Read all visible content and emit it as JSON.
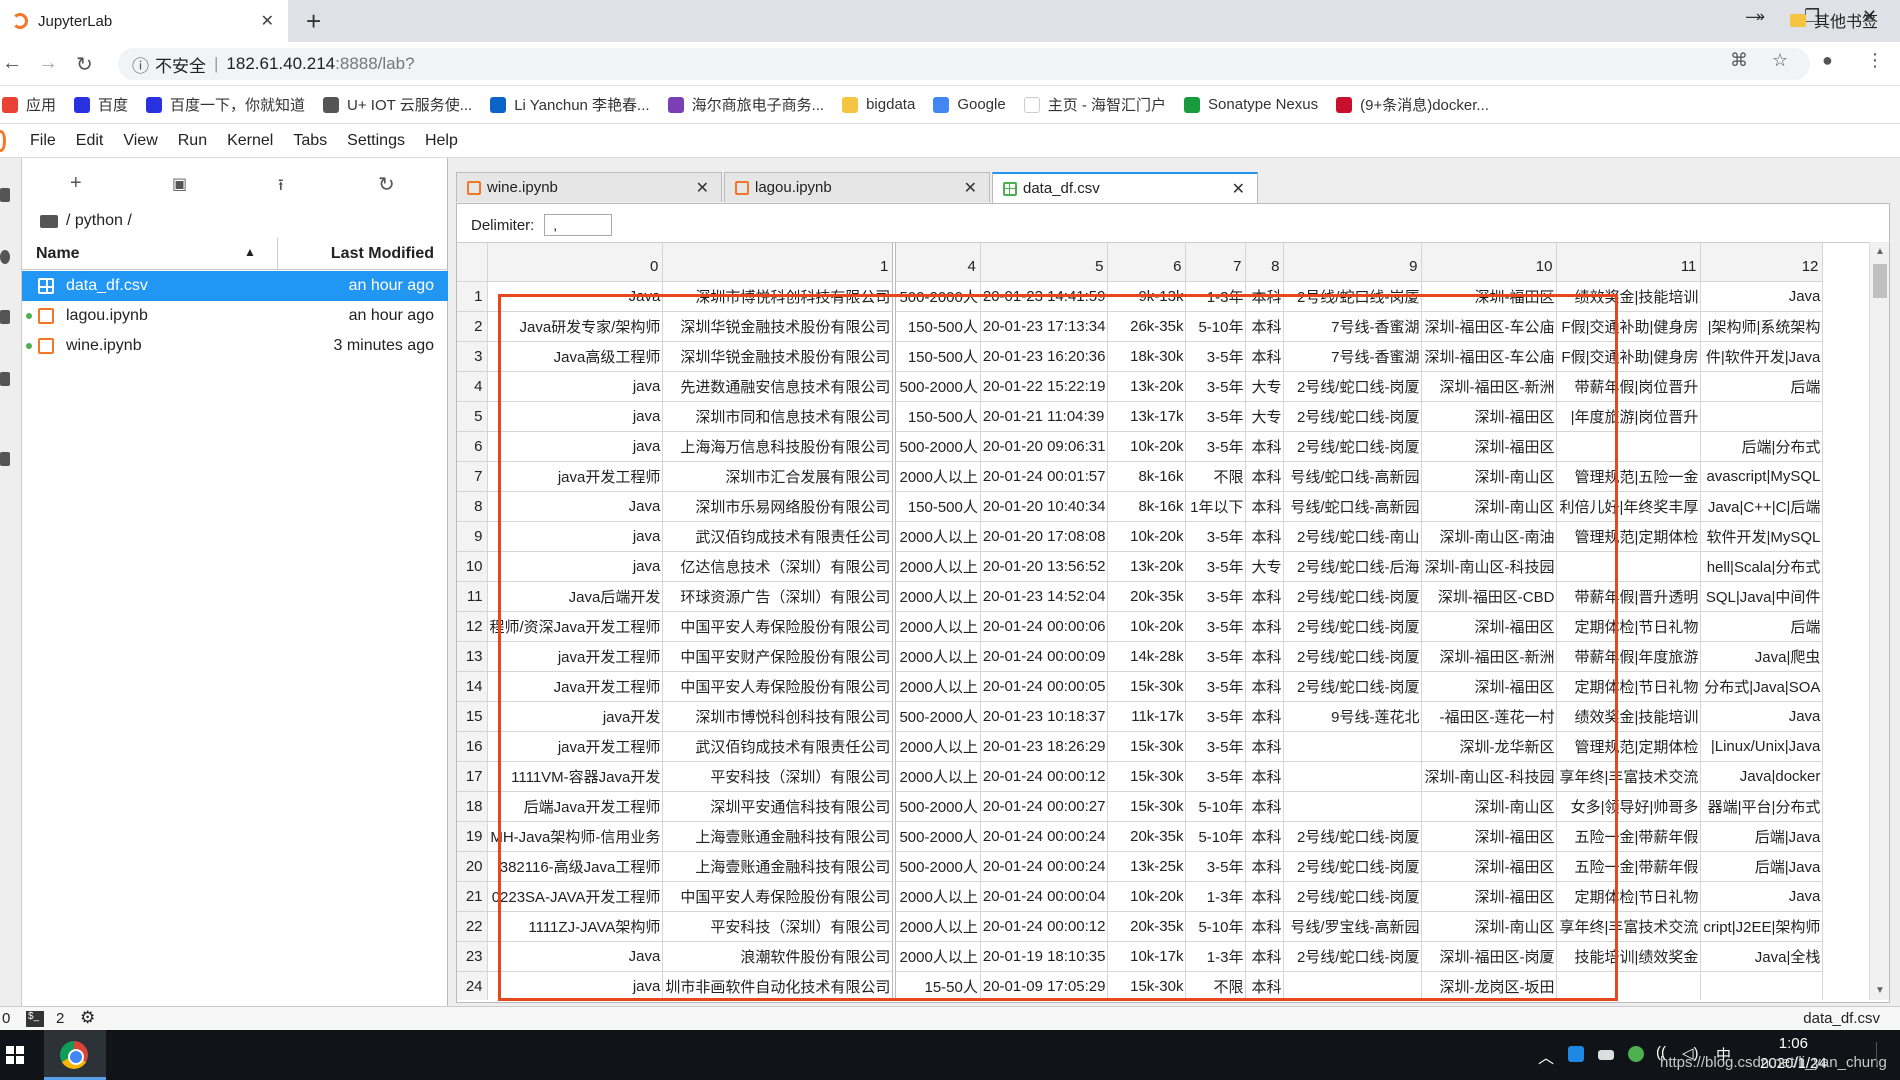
{
  "browser": {
    "tab_title": "JupyterLab",
    "address": {
      "warning": "不安全",
      "host": "182.61.40.214",
      "rest": ":8888/lab?"
    },
    "bookmarks": [
      {
        "label": "应用",
        "icon": "apps-grid-icon",
        "color": "#e94235"
      },
      {
        "label": "百度",
        "icon": "baidu-paw-icon",
        "color": "#2932e1"
      },
      {
        "label": "百度一下，你就知道",
        "icon": "baidu-paw-icon",
        "color": "#2932e1"
      },
      {
        "label": "U+ IOT 云服务使...",
        "icon": "globe-icon",
        "color": "#555555"
      },
      {
        "label": "Li Yanchun 李艳春...",
        "icon": "outlook-icon",
        "color": "#0a64c8"
      },
      {
        "label": "海尔商旅电子商务...",
        "icon": "colorful-ball-icon",
        "color": "#7b3fb5"
      },
      {
        "label": "bigdata",
        "icon": "folder-icon",
        "color": "#f5c542"
      },
      {
        "label": "Google",
        "icon": "google-icon",
        "color": "#4285f4"
      },
      {
        "label": "主页 - 海智汇门户",
        "icon": "blank-page-icon",
        "color": "#ffffff"
      },
      {
        "label": "Sonatype Nexus",
        "icon": "nexus-icon",
        "color": "#1a9c3e"
      },
      {
        "label": "(9+条消息)docker...",
        "icon": "csdn-icon",
        "color": "#c8102e"
      }
    ],
    "more_label": "»",
    "other_bookmarks": "其他书签"
  },
  "menu": [
    "File",
    "Edit",
    "View",
    "Run",
    "Kernel",
    "Tabs",
    "Settings",
    "Help"
  ],
  "filebrowser": {
    "breadcrumb": "/ python /",
    "col_name": "Name",
    "col_modified": "Last Modified",
    "files": [
      {
        "name": "data_df.csv",
        "modified": "an hour ago",
        "selected": true,
        "type": "csv",
        "running": false
      },
      {
        "name": "lagou.ipynb",
        "modified": "an hour ago",
        "selected": false,
        "type": "notebook",
        "running": true
      },
      {
        "name": "wine.ipynb",
        "modified": "3 minutes ago",
        "selected": false,
        "type": "notebook",
        "running": true
      }
    ]
  },
  "doc_tabs": [
    {
      "label": "wine.ipynb",
      "active": false,
      "type": "notebook"
    },
    {
      "label": "lagou.ipynb",
      "active": false,
      "type": "notebook"
    },
    {
      "label": "data_df.csv",
      "active": true,
      "type": "csv"
    }
  ],
  "delimiter": {
    "label": "Delimiter:",
    "value": ","
  },
  "grid": {
    "columns": [
      "0",
      "1",
      "4",
      "5",
      "6",
      "7",
      "8",
      "9",
      "10",
      "11",
      "12"
    ],
    "rows": [
      {
        "i": "1",
        "c": [
          "Java",
          "深圳市博悦科创科技有限公司",
          "500-2000人",
          "20-01-23 14:41:59",
          "9k-13k",
          "1-3年",
          "本科",
          "2号线/蛇口线-岗厦",
          "深圳-福田区",
          "绩效奖金|技能培训",
          "Java"
        ]
      },
      {
        "i": "2",
        "c": [
          "Java研发专家/架构师",
          "深圳华锐金融技术股份有限公司",
          "150-500人",
          "20-01-23 17:13:34",
          "26k-35k",
          "5-10年",
          "本科",
          "7号线-香蜜湖",
          "深圳-福田区-车公庙",
          "F假|交通补助|健身房",
          "|架构师|系统架构"
        ]
      },
      {
        "i": "3",
        "c": [
          "Java高级工程师",
          "深圳华锐金融技术股份有限公司",
          "150-500人",
          "20-01-23 16:20:36",
          "18k-30k",
          "3-5年",
          "本科",
          "7号线-香蜜湖",
          "深圳-福田区-车公庙",
          "F假|交通补助|健身房",
          "件|软件开发|Java"
        ]
      },
      {
        "i": "4",
        "c": [
          "java",
          "先进数通融安信息技术有限公司",
          "500-2000人",
          "20-01-22 15:22:19",
          "13k-20k",
          "3-5年",
          "大专",
          "2号线/蛇口线-岗厦",
          "深圳-福田区-新洲",
          "带薪年假|岗位晋升",
          "后端"
        ]
      },
      {
        "i": "5",
        "c": [
          "java",
          "深圳市同和信息技术有限公司",
          "150-500人",
          "20-01-21 11:04:39",
          "13k-17k",
          "3-5年",
          "大专",
          "2号线/蛇口线-岗厦",
          "深圳-福田区",
          "|年度旅游|岗位晋升",
          ""
        ]
      },
      {
        "i": "6",
        "c": [
          "java",
          "上海海万信息科技股份有限公司",
          "500-2000人",
          "20-01-20 09:06:31",
          "10k-20k",
          "3-5年",
          "本科",
          "2号线/蛇口线-岗厦",
          "深圳-福田区",
          "",
          "后端|分布式"
        ]
      },
      {
        "i": "7",
        "c": [
          "java开发工程师",
          "深圳市汇合发展有限公司",
          "2000人以上",
          "20-01-24 00:01:57",
          "8k-16k",
          "不限",
          "本科",
          "号线/蛇口线-高新园",
          "深圳-南山区",
          "管理规范|五险一金",
          "avascript|MySQL"
        ]
      },
      {
        "i": "8",
        "c": [
          "Java",
          "深圳市乐易网络股份有限公司",
          "150-500人",
          "20-01-20 10:40:34",
          "8k-16k",
          "1年以下",
          "本科",
          "号线/蛇口线-高新园",
          "深圳-南山区",
          "利倍儿好|年终奖丰厚",
          "Java|C++|C|后端"
        ]
      },
      {
        "i": "9",
        "c": [
          "java",
          "武汉佰钧成技术有限责任公司",
          "2000人以上",
          "20-01-20 17:08:08",
          "10k-20k",
          "3-5年",
          "本科",
          "2号线/蛇口线-南山",
          "深圳-南山区-南油",
          "管理规范|定期体检",
          "软件开发|MySQL"
        ]
      },
      {
        "i": "10",
        "c": [
          "java",
          "亿达信息技术（深圳）有限公司",
          "2000人以上",
          "20-01-20 13:56:52",
          "13k-20k",
          "3-5年",
          "大专",
          "2号线/蛇口线-后海",
          "深圳-南山区-科技园",
          "",
          "hell|Scala|分布式"
        ]
      },
      {
        "i": "11",
        "c": [
          "Java后端开发",
          "环球资源广告（深圳）有限公司",
          "2000人以上",
          "20-01-23 14:52:04",
          "20k-35k",
          "3-5年",
          "本科",
          "2号线/蛇口线-岗厦",
          "深圳-福田区-CBD",
          "带薪年假|晋升透明",
          "SQL|Java|中间件"
        ]
      },
      {
        "i": "12",
        "c": [
          "程师/资深Java开发工程师",
          "中国平安人寿保险股份有限公司",
          "2000人以上",
          "20-01-24 00:00:06",
          "10k-20k",
          "3-5年",
          "本科",
          "2号线/蛇口线-岗厦",
          "深圳-福田区",
          "定期体检|节日礼物",
          "后端"
        ]
      },
      {
        "i": "13",
        "c": [
          "java开发工程师",
          "中国平安财产保险股份有限公司",
          "2000人以上",
          "20-01-24 00:00:09",
          "14k-28k",
          "3-5年",
          "本科",
          "2号线/蛇口线-岗厦",
          "深圳-福田区-新洲",
          "带薪年假|年度旅游",
          "Java|爬虫"
        ]
      },
      {
        "i": "14",
        "c": [
          "Java开发工程师",
          "中国平安人寿保险股份有限公司",
          "2000人以上",
          "20-01-24 00:00:05",
          "15k-30k",
          "3-5年",
          "本科",
          "2号线/蛇口线-岗厦",
          "深圳-福田区",
          "定期体检|节日礼物",
          "分布式|Java|SOA"
        ]
      },
      {
        "i": "15",
        "c": [
          "java开发",
          "深圳市博悦科创科技有限公司",
          "500-2000人",
          "20-01-23 10:18:37",
          "11k-17k",
          "3-5年",
          "本科",
          "9号线-莲花北",
          "-福田区-莲花一村",
          "绩效奖金|技能培训",
          "Java"
        ]
      },
      {
        "i": "16",
        "c": [
          "java开发工程师",
          "武汉佰钧成技术有限责任公司",
          "2000人以上",
          "20-01-23 18:26:29",
          "15k-30k",
          "3-5年",
          "本科",
          "",
          "深圳-龙华新区",
          "管理规范|定期体检",
          "|Linux/Unix|Java"
        ]
      },
      {
        "i": "17",
        "c": [
          "1111VM-容器Java开发",
          "平安科技（深圳）有限公司",
          "2000人以上",
          "20-01-24 00:00:12",
          "15k-30k",
          "3-5年",
          "本科",
          "",
          "深圳-南山区-科技园",
          "享年终|丰富技术交流",
          "Java|docker"
        ]
      },
      {
        "i": "18",
        "c": [
          "后端Java开发工程师",
          "深圳平安通信科技有限公司",
          "500-2000人",
          "20-01-24 00:00:27",
          "15k-30k",
          "5-10年",
          "本科",
          "",
          "深圳-南山区",
          "女多|领导好|帅哥多",
          "器端|平台|分布式"
        ]
      },
      {
        "i": "19",
        "c": [
          "MH-Java架构师-信用业务",
          "上海壹账通金融科技有限公司",
          "500-2000人",
          "20-01-24 00:00:24",
          "20k-35k",
          "5-10年",
          "本科",
          "2号线/蛇口线-岗厦",
          "深圳-福田区",
          "五险一金|带薪年假",
          "后端|Java"
        ]
      },
      {
        "i": "20",
        "c": [
          "382116-高级Java工程师",
          "上海壹账通金融科技有限公司",
          "500-2000人",
          "20-01-24 00:00:24",
          "13k-25k",
          "3-5年",
          "本科",
          "2号线/蛇口线-岗厦",
          "深圳-福田区",
          "五险一金|带薪年假",
          "后端|Java"
        ]
      },
      {
        "i": "21",
        "c": [
          "0223SA-JAVA开发工程师",
          "中国平安人寿保险股份有限公司",
          "2000人以上",
          "20-01-24 00:00:04",
          "10k-20k",
          "1-3年",
          "本科",
          "2号线/蛇口线-岗厦",
          "深圳-福田区",
          "定期体检|节日礼物",
          "Java"
        ]
      },
      {
        "i": "22",
        "c": [
          "1111ZJ-JAVA架构师",
          "平安科技（深圳）有限公司",
          "2000人以上",
          "20-01-24 00:00:12",
          "20k-35k",
          "5-10年",
          "本科",
          "号线/罗宝线-高新园",
          "深圳-南山区",
          "享年终|丰富技术交流",
          "cript|J2EE|架构师"
        ]
      },
      {
        "i": "23",
        "c": [
          "Java",
          "浪潮软件股份有限公司",
          "2000人以上",
          "20-01-19 18:10:35",
          "10k-17k",
          "1-3年",
          "本科",
          "2号线/蛇口线-岗厦",
          "深圳-福田区-岗厦",
          "技能培训|绩效奖金",
          "Java|全栈"
        ]
      },
      {
        "i": "24",
        "c": [
          "java",
          "圳市非画软件自动化技术有限公司",
          "15-50人",
          "20-01-09 17:05:29",
          "15k-30k",
          "不限",
          "本科",
          "",
          "深圳-龙岗区-坂田",
          "",
          ""
        ]
      }
    ]
  },
  "statusbar": {
    "left1": "0",
    "left2": "2",
    "right": "data_df.csv"
  },
  "taskbar": {
    "time": "1:06",
    "date": "2020/1/24",
    "watermark": "https://blog.csdn.net/li_yan_chung"
  },
  "colors": {
    "accent": "#2196f3",
    "jupyter_orange": "#f37726",
    "highlight": "#e8471b"
  }
}
